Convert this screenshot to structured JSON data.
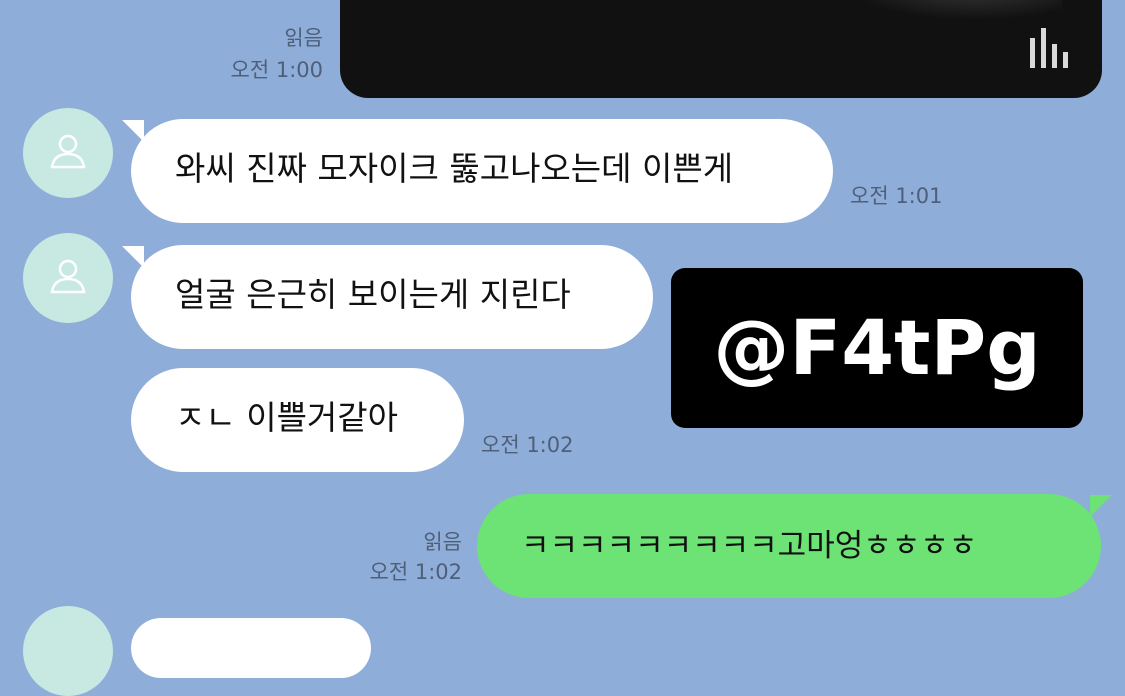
{
  "chat": {
    "top": {
      "read": "읽음",
      "time": "오전 1:00"
    },
    "messages": [
      {
        "text": "와씨 진짜 모자이크 뚫고나오는데 이쁜게",
        "time": "오전 1:01"
      },
      {
        "text": "얼굴 은근히 보이는게 지린다"
      },
      {
        "text": "ㅈㄴ 이쁠거같아",
        "time": "오전 1:02"
      }
    ],
    "mine": {
      "text": "ㅋㅋㅋㅋㅋㅋㅋㅋㅋ고마엉ㅎㅎㅎㅎ",
      "read": "읽음",
      "time": "오전 1:02"
    }
  },
  "watermark": "@F4tPg",
  "colors": {
    "background": "#8eadd8",
    "my_bubble": "#6de375",
    "avatar": "#c7e9e2"
  },
  "icons": [
    "default-profile-icon",
    "audio-bars-icon"
  ]
}
